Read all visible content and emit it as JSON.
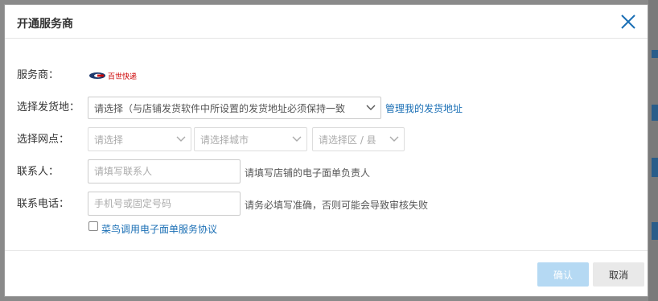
{
  "dialog": {
    "title": "开通服务商",
    "close_icon": "close-icon"
  },
  "form": {
    "provider": {
      "label": "服务商：",
      "logo_text": "百世快递"
    },
    "ship_from": {
      "label": "选择发货地：",
      "select_value": "请选择（与店铺发货软件中所设置的发货地址必须保持一致",
      "manage_link": "管理我的发货地址"
    },
    "branch": {
      "label": "选择网点：",
      "province_placeholder": "请选择",
      "city_placeholder": "请选择城市",
      "district_placeholder": "请选择区 / 县"
    },
    "contact": {
      "label": "联系人：",
      "placeholder": "请填写联系人",
      "hint": "请填写店铺的电子面单负责人"
    },
    "phone": {
      "label": "联系电话：",
      "placeholder": "手机号或固定号码",
      "hint": "请务必填写准确，否则可能会导致审核失败"
    },
    "agreement": {
      "checked": false,
      "link": "菜鸟调用电子面单服务协议"
    }
  },
  "footer": {
    "confirm_label": "确认",
    "cancel_label": "取消"
  },
  "colors": {
    "link": "#1a6fb5",
    "confirm_disabled": "#b5d9f3",
    "cancel": "#e9e9e9"
  }
}
